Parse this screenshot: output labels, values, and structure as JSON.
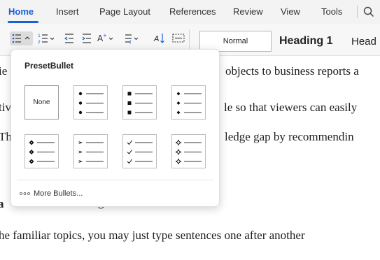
{
  "tabs": [
    {
      "label": "Home",
      "active": true
    },
    {
      "label": "Insert",
      "active": false
    },
    {
      "label": "Page Layout",
      "active": false
    },
    {
      "label": "References",
      "active": false
    },
    {
      "label": "Review",
      "active": false
    },
    {
      "label": "View",
      "active": false
    },
    {
      "label": "Tools",
      "active": false
    }
  ],
  "ribbon": {
    "styles": {
      "normal": "Normal",
      "heading1": "Heading 1",
      "heading2_partial": "Head"
    }
  },
  "document": {
    "lines": [
      "objects to business reports a",
      "le so that viewers can easily",
      "ledge gap by recommendin",
      "he familiar topics, you may just type sentences one after another"
    ],
    "partial_left": [
      "ie",
      "tiv",
      "Th",
      "a"
    ],
    "heading_fragment": "g"
  },
  "bullet_panel": {
    "title": "PresetBullet",
    "none_label": "None",
    "bullet_styles": [
      {
        "name": "filled-circle",
        "symbol": "●"
      },
      {
        "name": "filled-square",
        "symbol": "■"
      },
      {
        "name": "small-diamond",
        "symbol": "◆"
      },
      {
        "name": "fancy-diamond",
        "symbol": "❖"
      },
      {
        "name": "arrowhead",
        "symbol": "➤"
      },
      {
        "name": "check-mark",
        "symbol": "✓"
      },
      {
        "name": "outline-diamond-star",
        "symbol": "✧"
      }
    ],
    "more_label": "More Bullets..."
  },
  "colors": {
    "accent": "#1a5fd6",
    "tabbar_bg": "#f3f3f3",
    "ribbon_bg": "#f7f7f7"
  }
}
